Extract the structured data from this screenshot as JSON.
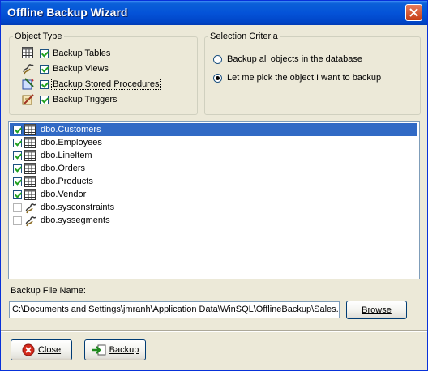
{
  "window": {
    "title": "Offline Backup Wizard"
  },
  "object_type": {
    "legend": "Object Type",
    "items": [
      {
        "label": "Backup Tables",
        "checked": true,
        "icon": "table-icon"
      },
      {
        "label": "Backup Views",
        "checked": true,
        "icon": "view-icon"
      },
      {
        "label": "Backup Stored Procedures",
        "checked": true,
        "icon": "procedure-icon"
      },
      {
        "label": "Backup Triggers",
        "checked": true,
        "icon": "trigger-icon"
      }
    ]
  },
  "selection_criteria": {
    "legend": "Selection Criteria",
    "options": [
      {
        "label": "Backup all objects in the database",
        "selected": false
      },
      {
        "label": "Let me pick the object I want to backup",
        "selected": true
      }
    ]
  },
  "objects": [
    {
      "name": "dbo.Customers",
      "checked": true,
      "icon": "table-icon",
      "selected": true
    },
    {
      "name": "dbo.Employees",
      "checked": true,
      "icon": "table-icon"
    },
    {
      "name": "dbo.LineItem",
      "checked": true,
      "icon": "table-icon"
    },
    {
      "name": "dbo.Orders",
      "checked": true,
      "icon": "table-icon"
    },
    {
      "name": "dbo.Products",
      "checked": true,
      "icon": "table-icon"
    },
    {
      "name": "dbo.Vendor",
      "checked": true,
      "icon": "table-icon"
    },
    {
      "name": "dbo.sysconstraints",
      "checked": false,
      "icon": "view-icon"
    },
    {
      "name": "dbo.syssegments",
      "checked": false,
      "icon": "view-icon"
    }
  ],
  "backup_file": {
    "label": "Backup File Name:",
    "value": "C:\\Documents and Settings\\jmranh\\Application Data\\WinSQL\\OfflineBackup\\Sales.ob",
    "browse_label": "Browse"
  },
  "footer": {
    "close_label": "Close",
    "backup_label": "Backup"
  },
  "colors": {
    "title_bar": "#0453d8",
    "selection": "#316ac5",
    "dialog_bg": "#ece9d8"
  }
}
